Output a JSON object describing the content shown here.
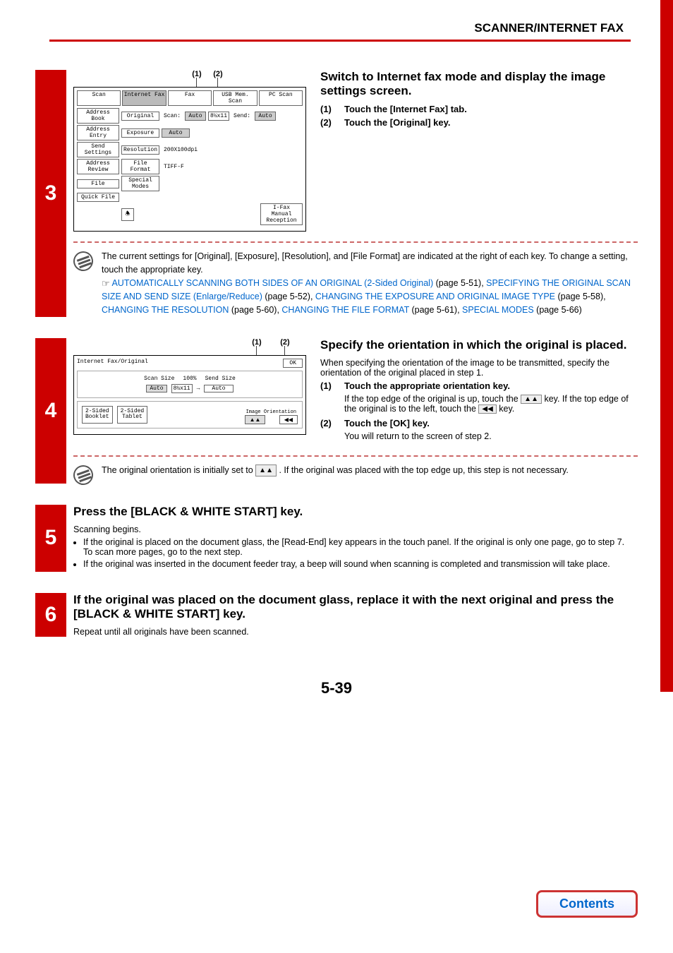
{
  "header": {
    "title": "SCANNER/INTERNET FAX"
  },
  "page_number": "5-39",
  "contents_btn": "Contents",
  "step3": {
    "num": "3",
    "callouts": {
      "c1": "(1)",
      "c2": "(2)"
    },
    "screen": {
      "tabs": [
        "Scan",
        "Internet Fax",
        "Fax",
        "USB Mem. Scan",
        "PC Scan"
      ],
      "side": [
        "Address Book",
        "Address Entry",
        "Send Settings",
        "Address Review",
        "File",
        "Quick File"
      ],
      "rows": {
        "original": {
          "label": "Original",
          "scan_lbl": "Scan:",
          "scan_val": "Auto",
          "size": "8½x11",
          "send_lbl": "Send:",
          "send_val": "Auto"
        },
        "exposure": {
          "label": "Exposure",
          "val": "Auto"
        },
        "resolution": {
          "label": "Resolution",
          "val": "200X100dpi"
        },
        "fileformat": {
          "label": "File Format",
          "val": "TIFF-F"
        },
        "special": {
          "label": "Special Modes"
        }
      },
      "bottom_btn": "I-Fax Manual\nReception"
    },
    "heading": "Switch to Internet fax mode and display the image settings screen.",
    "items": [
      {
        "lbl": "(1)",
        "txt": "Touch the [Internet Fax] tab."
      },
      {
        "lbl": "(2)",
        "txt": "Touch the [Original] key."
      }
    ],
    "note_intro": "The current settings for [Original], [Exposure], [Resolution], and [File Format] are indicated at the right of each key. To change a setting, touch the appropriate key.",
    "links": {
      "l1": "AUTOMATICALLY SCANNING BOTH SIDES OF AN ORIGINAL (2-Sided Original)",
      "p1": " (page 5-51), ",
      "l2": "SPECIFYING THE ORIGINAL SCAN SIZE AND SEND SIZE (Enlarge/Reduce)",
      "p2": " (page 5-52), ",
      "l3": "CHANGING THE EXPOSURE AND ORIGINAL IMAGE TYPE",
      "p3": " (page 5-58), ",
      "l4": "CHANGING THE RESOLUTION",
      "p4": " (page 5-60), ",
      "l5": "CHANGING THE FILE FORMAT",
      "p5": " (page 5-61), ",
      "l6": "SPECIAL MODES",
      "p6": " (page 5-66)"
    }
  },
  "step4": {
    "num": "4",
    "callouts": {
      "c1": "(1)",
      "c2": "(2)"
    },
    "screen": {
      "title": "Internet Fax/Original",
      "ok": "OK",
      "scan_size_lbl": "Scan Size",
      "scan_pct": "100%",
      "send_size_lbl": "Send Size",
      "scan_auto": "Auto",
      "scan_dim": "8½x11",
      "arrow": "→",
      "send_auto": "Auto",
      "btn_booklet": "2-Sided\nBooklet",
      "btn_tablet": "2-Sided\nTablet",
      "img_orient_lbl": "Image Orientation"
    },
    "heading": "Specify the orientation in which the original is placed.",
    "intro": "When specifying the orientation of the image to be transmitted, specify the orientation of the original placed in step 1.",
    "item1": {
      "lbl": "(1)",
      "txt": "Touch the appropriate orientation key."
    },
    "item1_desc_a": "If the top edge of the original is up, touch the ",
    "item1_desc_b": " key. If the top edge of the original is to the left, touch the ",
    "item1_desc_c": " key.",
    "item2": {
      "lbl": "(2)",
      "txt": "Touch the [OK] key."
    },
    "item2_desc": "You will return to the screen of step 2.",
    "note_a": "The original orientation is initially set to ",
    "note_b": " . If the original was placed with the top edge up, this step is not necessary."
  },
  "step5": {
    "num": "5",
    "heading": "Press the [BLACK & WHITE START] key.",
    "line1": "Scanning begins.",
    "b1": "If the original is placed on the document glass, the [Read-End] key appears in the touch panel. If the original is only one page, go to step 7. To scan more pages, go to the next step.",
    "b2": "If the original was inserted in the document feeder tray, a beep will sound when scanning is completed and transmission will take place."
  },
  "step6": {
    "num": "6",
    "heading": "If the original was placed on the document glass, replace it with the next original and press the [BLACK & WHITE START] key.",
    "line1": "Repeat until all originals have been scanned."
  }
}
